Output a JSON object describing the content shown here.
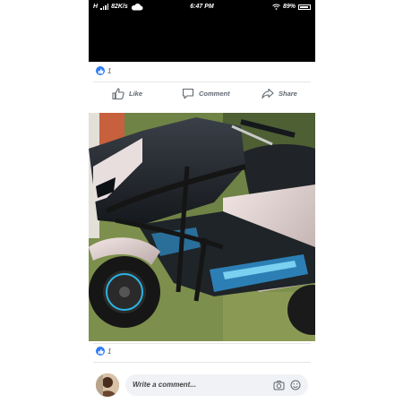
{
  "status_bar": {
    "carrier": "H",
    "speed": "82K/s",
    "time": "6:47 PM",
    "battery": "89%"
  },
  "post": {
    "reactions_count": "1",
    "actions": {
      "like": "Like",
      "comment": "Comment",
      "share": "Share"
    }
  },
  "photo": {
    "icons": [
      "motorcycle-photo"
    ]
  },
  "footer": {
    "reactions_count": "1",
    "comment_placeholder": "Write a comment..."
  }
}
